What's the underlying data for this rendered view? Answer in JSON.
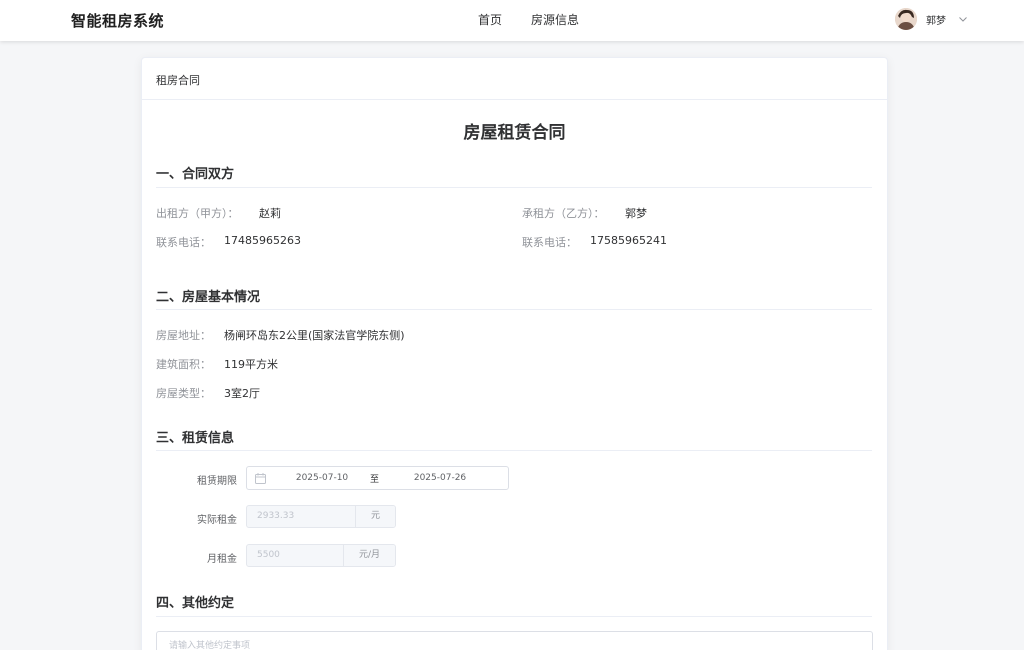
{
  "header": {
    "app_title": "智能租房系统",
    "nav": [
      "首页",
      "房源信息"
    ],
    "user_name": "郭梦"
  },
  "card": {
    "header_title": "租房合同",
    "document_title": "房屋租赁合同"
  },
  "parties": {
    "section_title": "一、合同双方",
    "landlord_label": "出租方（甲方）：",
    "landlord_name": "赵莉",
    "tenant_label": "承租方（乙方）：",
    "tenant_name": "郭梦",
    "landlord_phone_label": "联系电话：",
    "landlord_phone": "17485965263",
    "tenant_phone_label": "联系电话：",
    "tenant_phone": "17585965241"
  },
  "house": {
    "section_title": "二、房屋基本情况",
    "address_label": "房屋地址：",
    "address": "杨闸环岛东2公里(国家法官学院东侧)",
    "area_label": "建筑面积：",
    "area": "119平方米",
    "type_label": "房屋类型：",
    "type": "3室2厅"
  },
  "lease": {
    "section_title": "三、租赁信息",
    "period_label": "租赁期限",
    "start_date": "2025-07-10",
    "range_separator": "至",
    "end_date": "2025-07-26",
    "actual_rent_label": "实际租金",
    "actual_rent_value": "2933.33",
    "actual_rent_unit": "元",
    "monthly_rent_label": "月租金",
    "monthly_rent_value": "5500",
    "monthly_rent_unit": "元/月"
  },
  "other": {
    "section_title": "四、其他约定",
    "placeholder": "请输入其他约定事项"
  },
  "colors": {
    "label_gray": "#909399",
    "text_dark": "#303133",
    "border": "#dcdfe6",
    "disabled_bg": "#f5f7fa"
  }
}
